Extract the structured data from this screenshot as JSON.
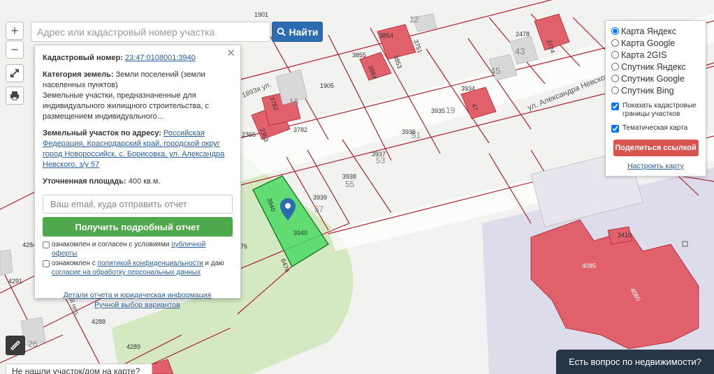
{
  "search": {
    "placeholder": "Адрес или кадастровый номер участка",
    "button_label": "Найти"
  },
  "zoom": {
    "in_label": "+",
    "out_label": "−"
  },
  "map_labels": [
    {
      "text": "1905"
    },
    {
      "text": "3854"
    },
    {
      "text": "3853"
    },
    {
      "text": "3855"
    },
    {
      "text": "3884"
    },
    {
      "text": "2478"
    },
    {
      "text": "43"
    },
    {
      "text": "45"
    },
    {
      "text": "3934"
    },
    {
      "text": "47"
    },
    {
      "text": "3935"
    },
    {
      "text": "19"
    },
    {
      "text": "3936"
    },
    {
      "text": "51"
    },
    {
      "text": "3937"
    },
    {
      "text": "53"
    },
    {
      "text": "3938"
    },
    {
      "text": "55"
    },
    {
      "text": "3939"
    },
    {
      "text": "57"
    },
    {
      "text": "3940"
    },
    {
      "text": "3940"
    },
    {
      "text": "3782"
    },
    {
      "text": "3782"
    },
    {
      "text": "16"
    },
    {
      "text": "2365"
    },
    {
      "text": "2353"
    },
    {
      "text": "6476"
    },
    {
      "text": "4284"
    },
    {
      "text": "4291"
    },
    {
      "text": "4288"
    },
    {
      "text": "4289"
    },
    {
      "text": "26"
    },
    {
      "text": "3410"
    },
    {
      "text": "4085"
    },
    {
      "text": "4085"
    },
    {
      "text": "12"
    },
    {
      "text": "1901"
    },
    {
      "text": "3724"
    },
    {
      "text": "3751"
    },
    {
      "text": "76"
    }
  ],
  "streets": {
    "nevskogo": "ул. Александра Невского",
    "vostochnaya": "1893я ул.",
    "per": "ей пер."
  },
  "popup": {
    "cad_label": "Кадастровый номер:",
    "cad_value": "23:47:0108001:3940",
    "cat_label": "Категория земель:",
    "cat_value": "Земли поселений (земли населенных пунктов)",
    "use_desc": "Земельные участки, предназначенные для индивидуального жилищного строительства, с размещением индивидуального...",
    "addr_label": "Земельный участок по адресу:",
    "addr_value": "Российская Федерация, Краснодарский край, городской округ город Новороссийск, с. Борисовка, ул. Александра Невского, з/у 57",
    "area_label": "Уточненная площадь:",
    "area_value": "400 кв.м.",
    "email_placeholder": "Ваш email, куда отправить отчет",
    "report_button": "Получить подробный отчет",
    "agree1_text": "ознакомлен и согласен с условиями",
    "agree1_link": "публичной оферты",
    "agree2_text": "ознакомлен с",
    "agree2_link": "политикой конфиденциальности",
    "agree2_mid": "и даю",
    "agree2_link2": "согласие на обработку персональных данных",
    "details_link": "Детали отчета и юридическая информация",
    "manual_link": "Ручной выбор вариантов"
  },
  "layers": {
    "options": [
      "Карта Яндекс",
      "Карта Google",
      "Карта 2GIS",
      "Спутник Яндекс",
      "Спутник Google",
      "Спутник Bing"
    ],
    "selected": "Карта Яндекс",
    "show_borders": "Показать кадастровые границы участков",
    "thematic": "Тематическая карта",
    "share_button": "Поделиться ссылкой",
    "configure_link": "Настроить карту"
  },
  "bottom": {
    "not_found": "Не нашли участок/дом на карте?",
    "question": "Есть вопрос по недвижимости?"
  },
  "colors": {
    "parcel_selected": "#4cd964",
    "building": "#e0606b",
    "parcel_line": "#b0202e",
    "accent_blue": "#2b6cb0",
    "green_button": "#4fa84a",
    "red_button": "#d9534f"
  }
}
